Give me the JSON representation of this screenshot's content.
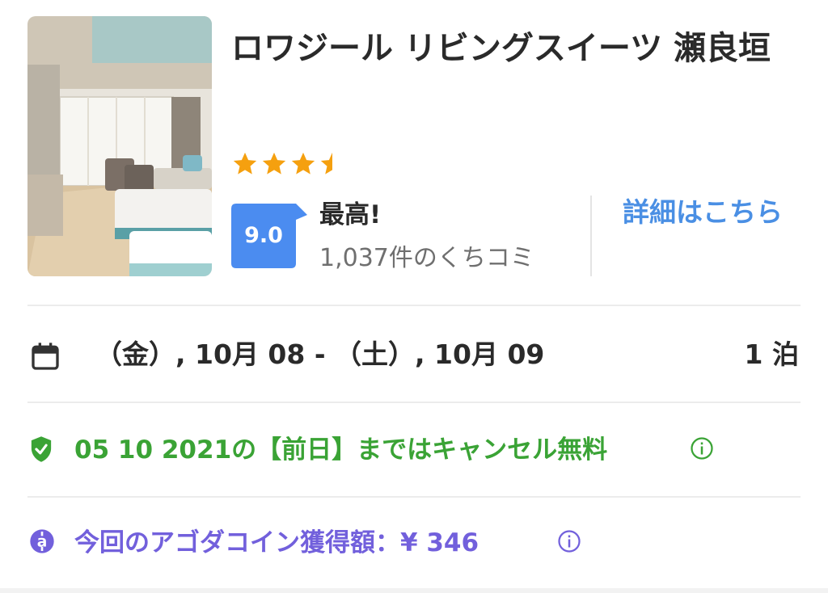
{
  "hotel": {
    "name": "ロワジール リビングスイーツ 瀬良垣",
    "star_rating": 3.5,
    "score": "9.0",
    "score_label": "最高!",
    "review_count": "1,037件のくちコミ",
    "details_link": "詳細はこちら"
  },
  "stay": {
    "dates": "（金）, 10月 08 - （土）, 10月 09",
    "nights": "1 泊"
  },
  "cancellation": {
    "text": "05 10 2021の【前日】まではキャンセル無料"
  },
  "coins": {
    "text": "今回のアゴダコイン獲得額：¥ 346"
  },
  "icons": {
    "calendar": "calendar-icon",
    "shield": "shield-check-icon",
    "coin": "agoda-coin-icon",
    "info": "info-icon",
    "star": "star-icon"
  },
  "colors": {
    "star": "#f5a00f",
    "score_badge": "#4b8cf0",
    "link": "#4a8fe4",
    "cancel_green": "#3aa335",
    "coin_purple": "#7260dc",
    "divider": "#ececec"
  }
}
